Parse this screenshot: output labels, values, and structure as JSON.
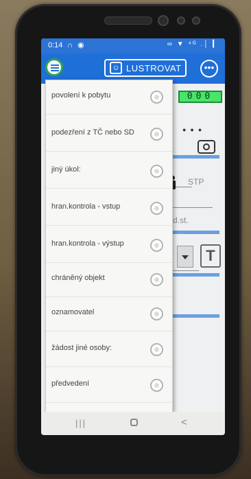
{
  "status_bar": {
    "time": "0:14",
    "left_icons": "∩ ◉",
    "right_icons": "∞ ▼ ⁴ᴳ .│ ▎"
  },
  "app_bar": {
    "menu_icon": "menu-icon",
    "lustrovat_label": "LUSTROVAT",
    "lustrovat_icon": "person-card-icon",
    "more_icon": "more-icon"
  },
  "background_form": {
    "counter_value": "000",
    "stp_placeholder": "STP",
    "dst_placeholder": "d.st.",
    "t_button_label": "T",
    "counter_color": "#48e56a"
  },
  "popup_menu": {
    "items": [
      {
        "label": "povolení k pobytu"
      },
      {
        "label": "podezření z TČ nebo SD"
      },
      {
        "label": "jiný úkol:"
      },
      {
        "label": "hran.kontrola - vstup"
      },
      {
        "label": "hran.kontrola - výstup"
      },
      {
        "label": "chráněný objekt"
      },
      {
        "label": "oznamovatel"
      },
      {
        "label": "žádost jiné osoby:"
      },
      {
        "label": "předvedení"
      }
    ]
  },
  "nav_bar": {
    "recent": "|||",
    "back": "<"
  },
  "colors": {
    "app_bar": "#1f6fd8",
    "status_bar": "#2c73d6",
    "accent_green": "#2ea44f"
  }
}
